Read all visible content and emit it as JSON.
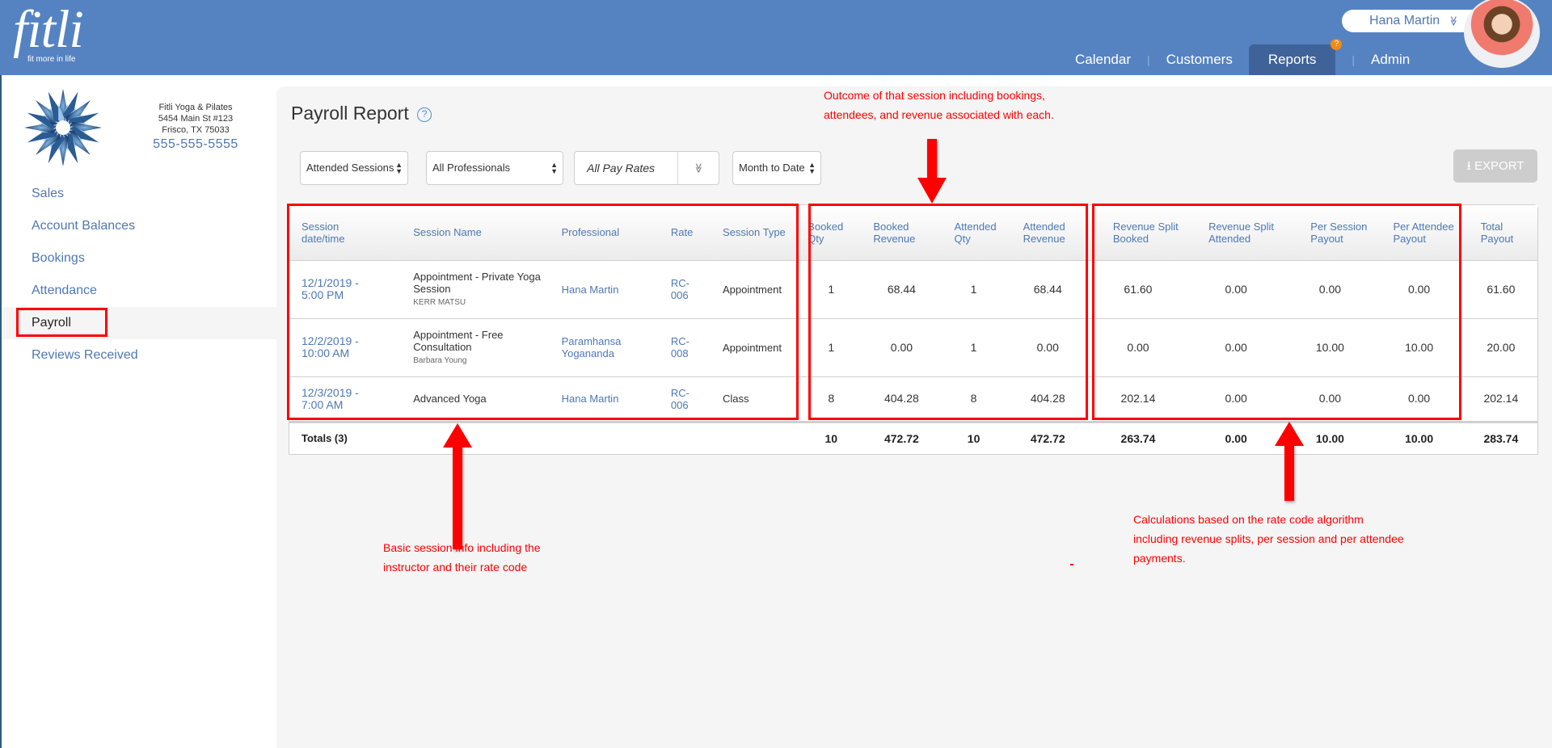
{
  "header": {
    "logo_word": "fitli",
    "logo_tagline": "fit more in life",
    "user_name": "Hana Martin",
    "user_chevron": "≫",
    "nav": [
      {
        "label": "Calendar"
      },
      {
        "label": "Customers"
      },
      {
        "label": "Reports",
        "active": true,
        "badge": "?"
      },
      {
        "label": "Admin"
      }
    ],
    "separator": "|"
  },
  "studio": {
    "name": "Fitli Yoga & Pilates",
    "address1": "5454 Main St #123",
    "address2": "Frisco, TX 75033",
    "phone": "555-555-5555"
  },
  "sidebar": {
    "items": [
      {
        "label": "Sales"
      },
      {
        "label": "Account Balances"
      },
      {
        "label": "Bookings"
      },
      {
        "label": "Attendance"
      },
      {
        "label": "Payroll",
        "active": true
      },
      {
        "label": "Reviews Received"
      }
    ]
  },
  "page": {
    "title": "Payroll Report",
    "help_icon": "?",
    "filters": {
      "session_filter": "Attended Sessions",
      "professional_filter": "All Professionals",
      "pay_rate_filter": "All Pay Rates",
      "date_range": "Month to Date"
    },
    "export_label": "EXPORT",
    "export_icon": "⭳"
  },
  "table": {
    "columns": [
      "Session date/time",
      "Session Name",
      "Professional",
      "Rate",
      "Session Type",
      "Booked Qty",
      "Booked Revenue",
      "Attended Qty",
      "Attended Revenue",
      "Revenue Split Booked",
      "Revenue Split Attended",
      "Per Session Payout",
      "Per Attendee Payout",
      "Total Payout"
    ],
    "column_lines": [
      [
        "Session",
        "date/time"
      ],
      [
        "Session Name"
      ],
      [
        "Professional"
      ],
      [
        "Rate"
      ],
      [
        "Session Type"
      ],
      [
        "Booked",
        "Qty"
      ],
      [
        "Booked",
        "Revenue"
      ],
      [
        "Attended",
        "Qty"
      ],
      [
        "Attended",
        "Revenue"
      ],
      [
        "Revenue Split",
        "Booked"
      ],
      [
        "Revenue Split",
        "Attended"
      ],
      [
        "Per Session",
        "Payout"
      ],
      [
        "Per Attendee",
        "Payout"
      ],
      [
        "Total",
        "Payout"
      ]
    ],
    "rows": [
      {
        "date": "12/1/2019 -",
        "time": "5:00 PM",
        "session_name": "Appointment - Private Yoga Session",
        "customer": "KERR MATSU",
        "professional": "Hana Martin",
        "rate": "RC-006",
        "session_type": "Appointment",
        "booked_qty": "1",
        "booked_revenue": "68.44",
        "attended_qty": "1",
        "attended_revenue": "68.44",
        "revenue_split_booked": "61.60",
        "revenue_split_attended": "0.00",
        "per_session_payout": "0.00",
        "per_attendee_payout": "0.00",
        "total_payout": "61.60"
      },
      {
        "date": "12/2/2019 -",
        "time": "10:00 AM",
        "session_name": "Appointment - Free Consultation",
        "customer": "Barbara Young",
        "professional": "Paramhansa Yogananda",
        "rate": "RC-008",
        "session_type": "Appointment",
        "booked_qty": "1",
        "booked_revenue": "0.00",
        "attended_qty": "1",
        "attended_revenue": "0.00",
        "revenue_split_booked": "0.00",
        "revenue_split_attended": "0.00",
        "per_session_payout": "10.00",
        "per_attendee_payout": "10.00",
        "total_payout": "20.00"
      },
      {
        "date": "12/3/2019 -",
        "time": "7:00 AM",
        "session_name": "Advanced Yoga",
        "customer": "",
        "professional": "Hana Martin",
        "rate": "RC-006",
        "session_type": "Class",
        "booked_qty": "8",
        "booked_revenue": "404.28",
        "attended_qty": "8",
        "attended_revenue": "404.28",
        "revenue_split_booked": "202.14",
        "revenue_split_attended": "0.00",
        "per_session_payout": "0.00",
        "per_attendee_payout": "0.00",
        "total_payout": "202.14"
      }
    ],
    "totals": {
      "label": "Totals (3)",
      "booked_qty": "10",
      "booked_revenue": "472.72",
      "attended_qty": "10",
      "attended_revenue": "472.72",
      "revenue_split_booked": "263.74",
      "revenue_split_attended": "0.00",
      "per_session_payout": "10.00",
      "per_attendee_payout": "10.00",
      "total_payout": "283.74"
    }
  },
  "annotations": {
    "outcome": [
      "Outcome of that session including bookings,",
      "attendees, and revenue associated with each."
    ],
    "basic": [
      "Basic session info including the",
      "instructor and their rate code"
    ],
    "calculations": [
      "Calculations based on the rate code algorithm",
      "including revenue splits, per session and per attendee",
      "payments."
    ],
    "color": "#ff0000"
  },
  "colors": {
    "brand_blue": "#5583c2",
    "nav_active": "#3f6398",
    "link_blue": "#4f78b4",
    "badge_orange": "#f28a13"
  }
}
